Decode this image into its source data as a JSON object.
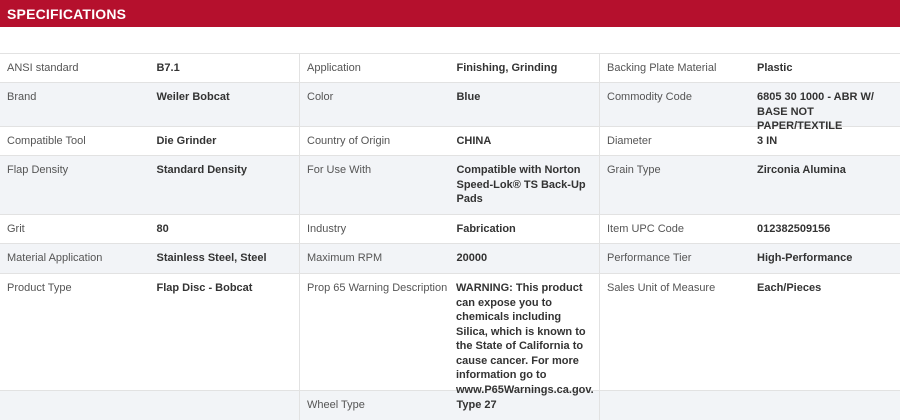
{
  "header": {
    "title": "SPECIFICATIONS"
  },
  "columns": [
    [
      {
        "label": "ANSI standard",
        "value": "B7.1"
      },
      {
        "label": "Brand",
        "value": "Weiler Bobcat"
      },
      {
        "label": "Compatible Tool",
        "value": "Die Grinder"
      },
      {
        "label": "Flap Density",
        "value": "Standard Density"
      },
      {
        "label": "Grit",
        "value": "80"
      },
      {
        "label": "Material Application",
        "value": "Stainless Steel, Steel"
      },
      {
        "label": "Product Type",
        "value": "Flap Disc - Bobcat"
      },
      {
        "label": "",
        "value": ""
      }
    ],
    [
      {
        "label": "Application",
        "value": "Finishing, Grinding"
      },
      {
        "label": "Color",
        "value": "Blue"
      },
      {
        "label": "Country of Origin",
        "value": "CHINA"
      },
      {
        "label": "For Use With",
        "value": "Compatible with Norton Speed-Lok® TS Back-Up Pads"
      },
      {
        "label": "Industry",
        "value": "Fabrication"
      },
      {
        "label": "Maximum RPM",
        "value": "20000"
      },
      {
        "label": "Prop 65 Warning Description",
        "value": "WARNING: This product can expose you to chemicals including Silica, which is known to the State of California to cause cancer. For more information go to www.P65Warnings.ca.gov."
      },
      {
        "label": "Wheel Type",
        "value": "Type 27"
      }
    ],
    [
      {
        "label": "Backing Plate Material",
        "value": "Plastic"
      },
      {
        "label": "Commodity Code",
        "value": "6805 30 1000 - ABR W/ BASE NOT PAPER/TEXTILE"
      },
      {
        "label": "Diameter",
        "value": "3 IN"
      },
      {
        "label": "Grain Type",
        "value": "Zirconia Alumina"
      },
      {
        "label": "Item UPC Code",
        "value": "012382509156"
      },
      {
        "label": "Performance Tier",
        "value": "High-Performance"
      },
      {
        "label": "Sales Unit of Measure",
        "value": "Each/Pieces"
      },
      {
        "label": "",
        "value": ""
      }
    ]
  ]
}
